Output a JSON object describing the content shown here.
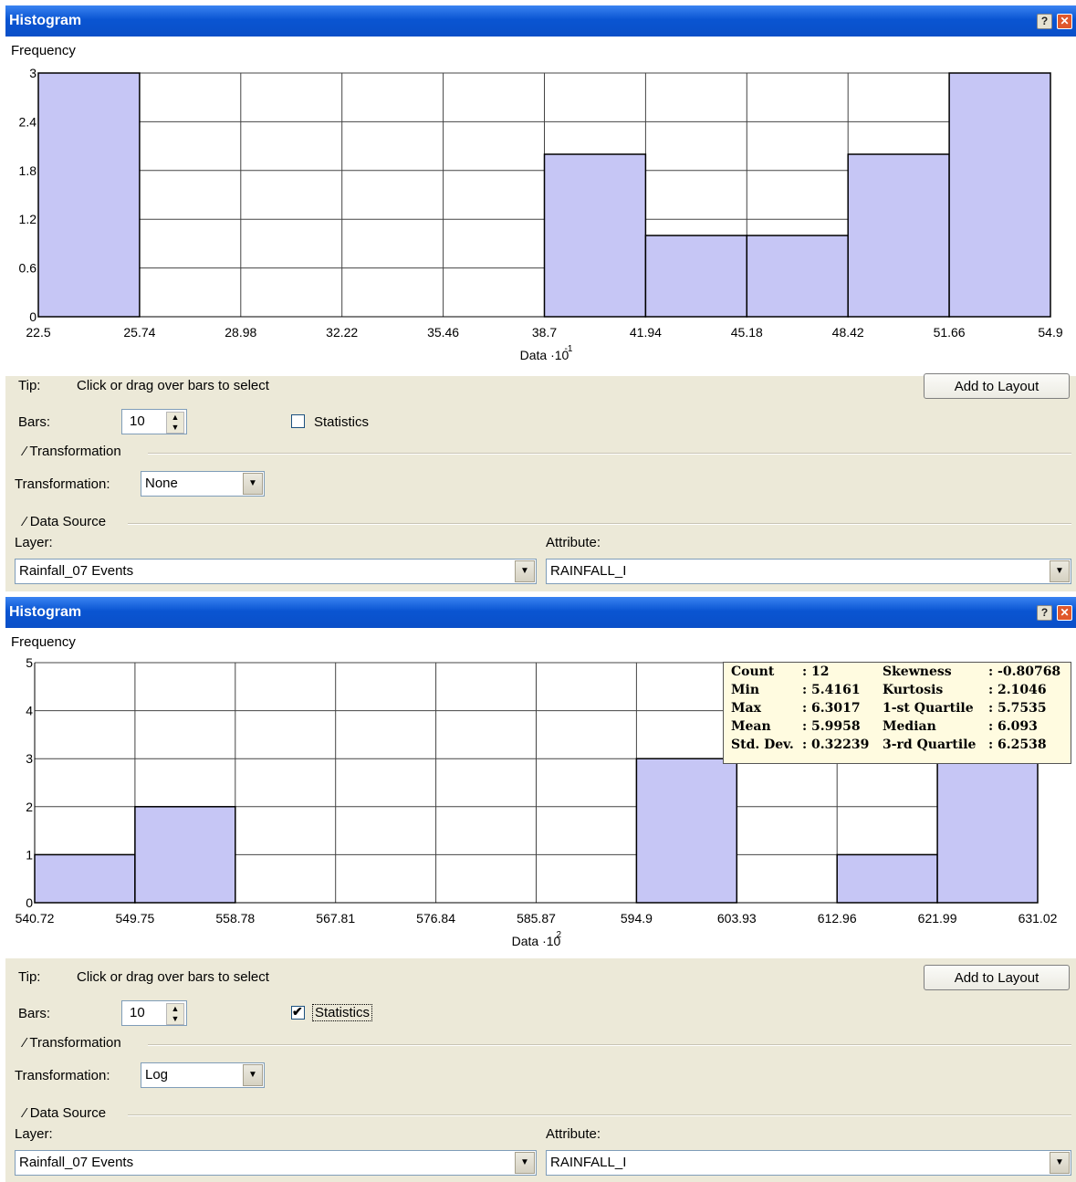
{
  "windows": [
    {
      "title": "Histogram",
      "yaxis_label": "Frequency",
      "x_exponent_label": "Data ·10",
      "x_exponent": "-1",
      "tip_label": "Tip:",
      "tip_text": "Click or drag over bars to select",
      "add_to_layout": "Add to Layout",
      "bars_label": "Bars:",
      "bars_value": "10",
      "statistics_label": "Statistics",
      "statistics_checked": false,
      "transformation_group": "Transformation",
      "transformation_label": "Transformation:",
      "transformation_value": "None",
      "data_source_group": "Data Source",
      "layer_label": "Layer:",
      "layer_value": "Rainfall_07 Events",
      "attribute_label": "Attribute:",
      "attribute_value": "RAINFALL_I"
    },
    {
      "title": "Histogram",
      "yaxis_label": "Frequency",
      "x_exponent_label": "Data ·10",
      "x_exponent": "2",
      "tip_label": "Tip:",
      "tip_text": "Click or drag over bars to select",
      "add_to_layout": "Add to Layout",
      "bars_label": "Bars:",
      "bars_value": "10",
      "statistics_label": "Statistics",
      "statistics_checked": true,
      "transformation_group": "Transformation",
      "transformation_label": "Transformation:",
      "transformation_value": "Log",
      "data_source_group": "Data Source",
      "layer_label": "Layer:",
      "layer_value": "Rainfall_07 Events",
      "attribute_label": "Attribute:",
      "attribute_value": "RAINFALL_I",
      "stats": {
        "count_label": "Count",
        "count": ": 12",
        "min_label": "Min",
        "min": ": 5.4161",
        "max_label": "Max",
        "max": ": 6.3017",
        "mean_label": "Mean",
        "mean": ": 5.9958",
        "std_label": "Std. Dev.",
        "std": ": 0.32239",
        "skew_label": "Skewness",
        "skew": ": -0.80768",
        "kurt_label": "Kurtosis",
        "kurt": ": 2.1046",
        "q1_label": "1-st Quartile",
        "q1": ": 5.7535",
        "median_label": "Median",
        "median": ": 6.093",
        "q3_label": "3-rd Quartile",
        "q3": ": 6.2538"
      }
    }
  ],
  "chart_data": [
    {
      "type": "bar",
      "ylabel": "Frequency",
      "xlabel": "Data ·10^-1",
      "x_ticks": [
        "22.5",
        "25.74",
        "28.98",
        "32.22",
        "35.46",
        "38.7",
        "41.94",
        "45.18",
        "48.42",
        "51.66",
        "54.9"
      ],
      "y_ticks": [
        "0",
        "0.6",
        "1.2",
        "1.8",
        "2.4",
        "3"
      ],
      "ylim": [
        0,
        3
      ],
      "values": [
        3,
        0,
        0,
        0,
        0,
        2,
        1,
        1,
        2,
        3
      ],
      "bar_color": "#c6c6f5",
      "grid": true
    },
    {
      "type": "bar",
      "ylabel": "Frequency",
      "xlabel": "Data ·10^2",
      "x_ticks": [
        "540.72",
        "549.75",
        "558.78",
        "567.81",
        "576.84",
        "585.87",
        "594.9",
        "603.93",
        "612.96",
        "621.99",
        "631.02"
      ],
      "y_ticks": [
        "0",
        "1",
        "2",
        "3",
        "4",
        "5"
      ],
      "ylim": [
        0,
        5
      ],
      "values": [
        1,
        2,
        0,
        0,
        0,
        0,
        3,
        0,
        1,
        4
      ],
      "bar_color": "#c6c6f5",
      "grid": true
    }
  ]
}
